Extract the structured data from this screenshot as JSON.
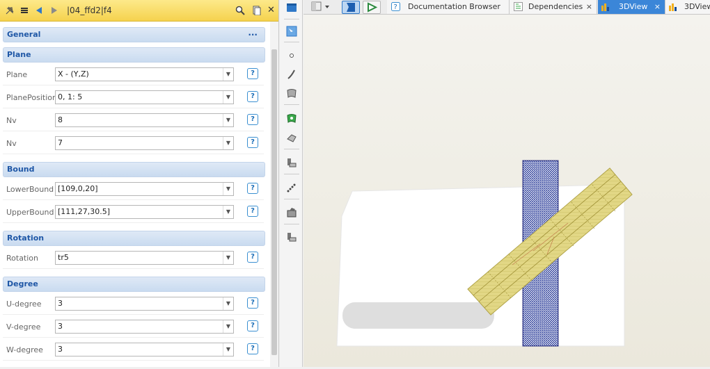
{
  "left_panel": {
    "breadcrumb": "|04_ffd2|f4",
    "sections": {
      "general": {
        "title": "General",
        "dots": "..."
      },
      "plane": {
        "title": "Plane"
      },
      "bound": {
        "title": "Bound"
      },
      "rotation": {
        "title": "Rotation"
      },
      "degree": {
        "title": "Degree"
      }
    },
    "props": {
      "plane": {
        "label": "Plane",
        "value": "X - (Y,Z)"
      },
      "plane_position": {
        "label": "PlanePosition",
        "value": "0, 1: 5"
      },
      "nv1": {
        "label": "Nv",
        "value": "8"
      },
      "nv2": {
        "label": "Nv",
        "value": "7"
      },
      "lower_bound": {
        "label": "LowerBound",
        "value": "[109,0,20]"
      },
      "upper_bound": {
        "label": "UpperBound",
        "value": "[111,27,30.5]"
      },
      "rotation": {
        "label": "Rotation",
        "value": "tr5"
      },
      "u_degree": {
        "label": "U-degree",
        "value": "3"
      },
      "v_degree": {
        "label": "V-degree",
        "value": "3"
      },
      "w_degree": {
        "label": "W-degree",
        "value": "3"
      }
    },
    "help_glyph": "?",
    "dropdown_glyph": "▼"
  },
  "tabs": [
    {
      "label": "Documentation Browser",
      "close": "×"
    },
    {
      "label": "Dependencies",
      "close": "×"
    },
    {
      "label": "3DView",
      "close": "×"
    },
    {
      "label": "3DView",
      "close": "×"
    }
  ],
  "colors": {
    "header_yellow": "#f5d24e",
    "section_blue": "#1f57a6",
    "active_tab": "#3b86d8"
  },
  "icons": [
    "pin-icon",
    "menu-icon",
    "back-arrow-icon",
    "forward-arrow-icon",
    "search-icon",
    "copy-icon",
    "close-icon",
    "window-icon",
    "layout-icon",
    "3d-mode-icon",
    "play-icon",
    "help-icon",
    "dependencies-icon",
    "chart-icon",
    "select-icon",
    "point-icon",
    "curve-icon",
    "surface-icon",
    "spline-icon",
    "solid-icon",
    "constraint-icon",
    "points-line-icon",
    "shape-icon"
  ]
}
